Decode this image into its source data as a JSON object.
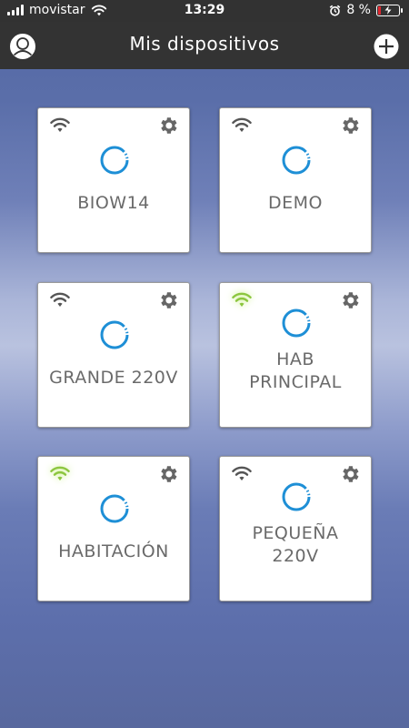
{
  "status_bar": {
    "carrier": "movistar",
    "time": "13:29",
    "battery_text": "8 %",
    "battery_level_percent": 8
  },
  "header": {
    "title": "Mis dispositivos",
    "profile_icon": "user-circle-icon",
    "add_icon": "plus-circle-icon"
  },
  "devices": [
    {
      "name": "BIOW14",
      "wifi_connected": false
    },
    {
      "name": "DEMO",
      "wifi_connected": false
    },
    {
      "name": "GRANDE 220V",
      "wifi_connected": false
    },
    {
      "name": "HAB\nPRINCIPAL",
      "wifi_connected": true
    },
    {
      "name": "HABITACIÓN",
      "wifi_connected": true
    },
    {
      "name": "PEQUEÑA\n220V",
      "wifi_connected": false
    }
  ],
  "colors": {
    "accent_blue": "#1e8fd6",
    "wifi_on": "#8cc63f",
    "wifi_off": "#555555",
    "gear": "#666666"
  }
}
